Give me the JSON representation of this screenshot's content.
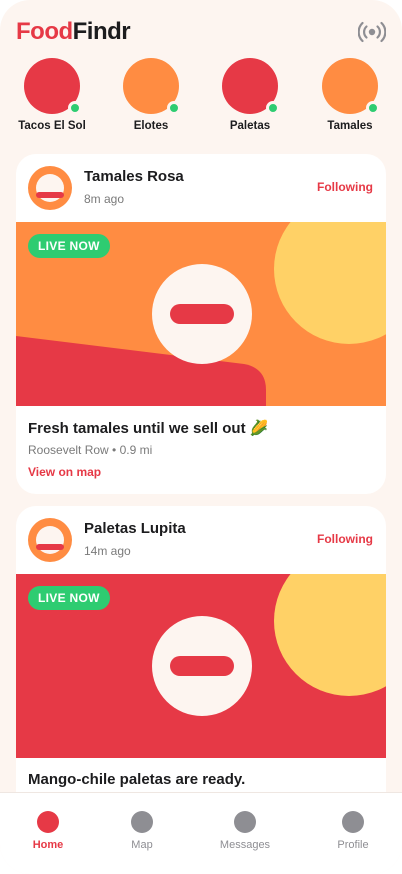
{
  "app": {
    "logo_part1": "Food",
    "logo_part2": "Findr",
    "live_icon": "broadcast-icon"
  },
  "stories": [
    {
      "name": "Tacos El Sol",
      "color": "#e63946"
    },
    {
      "name": "Elotes",
      "color": "#ff8c42"
    },
    {
      "name": "Paletas",
      "color": "#e63946"
    },
    {
      "name": "Tamales",
      "color": "#ff8c42"
    }
  ],
  "feed": [
    {
      "vendor": "Tamales Rosa",
      "time": "8m ago",
      "follow_label": "Following",
      "badge": "LIVE NOW",
      "media_color": "#ff8c42",
      "text": "Fresh tamales until we sell out 🌽",
      "location": "Roosevelt Row • 0.9 mi",
      "link": "View on map"
    },
    {
      "vendor": "Paletas Lupita",
      "time": "14m ago",
      "follow_label": "Following",
      "badge": "LIVE NOW",
      "media_color": "#e63946",
      "text": "Mango-chile paletas are ready."
    }
  ],
  "tabs": [
    {
      "label": "Home",
      "active": true
    },
    {
      "label": "Map"
    },
    {
      "label": "Messages"
    },
    {
      "label": "Profile"
    }
  ],
  "colors": {
    "accent": "#e63946",
    "orange": "#ff8c42",
    "yellow": "#ffd166",
    "live_green": "#2ecc71",
    "background": "#fdf5f0"
  }
}
